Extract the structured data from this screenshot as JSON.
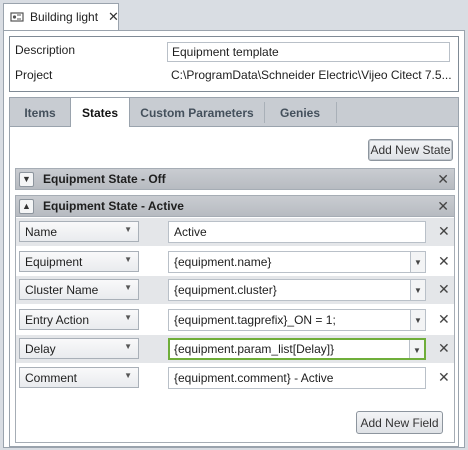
{
  "document_tab": {
    "title": "Building light",
    "close": "✕"
  },
  "properties": {
    "description_label": "Description",
    "description_value": "Equipment template",
    "project_label": "Project",
    "project_value": "C:\\ProgramData\\Schneider Electric\\Vijeo Citect 7.5..."
  },
  "tabs": [
    {
      "label": "Items",
      "active": false
    },
    {
      "label": "States",
      "active": true
    },
    {
      "label": "Custom Parameters",
      "active": false
    },
    {
      "label": "Genies",
      "active": false
    }
  ],
  "add_state_label": "Add New State",
  "states": {
    "off": {
      "title": "Equipment State - Off",
      "chevron": "▼",
      "remove": "✕"
    },
    "active": {
      "title": "Equipment State - Active",
      "chevron": "▲",
      "remove": "✕"
    }
  },
  "fields": [
    {
      "name": "Name",
      "value": "Active",
      "combo": false
    },
    {
      "name": "Equipment",
      "value": "{equipment.name}",
      "combo": true
    },
    {
      "name": "Cluster Name",
      "value": "{equipment.cluster}",
      "combo": true
    },
    {
      "name": "Entry Action",
      "value": "{equipment.tagprefix}_ON = 1;",
      "combo": true
    },
    {
      "name": "Delay",
      "value": "{equipment.param_list[Delay]}",
      "combo": true,
      "focused": true
    },
    {
      "name": "Comment",
      "value": "{equipment.comment} - Active",
      "combo": false
    }
  ],
  "field_remove": "✕",
  "dropdown_glyph": "▼",
  "add_field_label": "Add New Field",
  "colors": {
    "focus_border": "#6fae3a",
    "header_bg": "#c1c5cb"
  }
}
